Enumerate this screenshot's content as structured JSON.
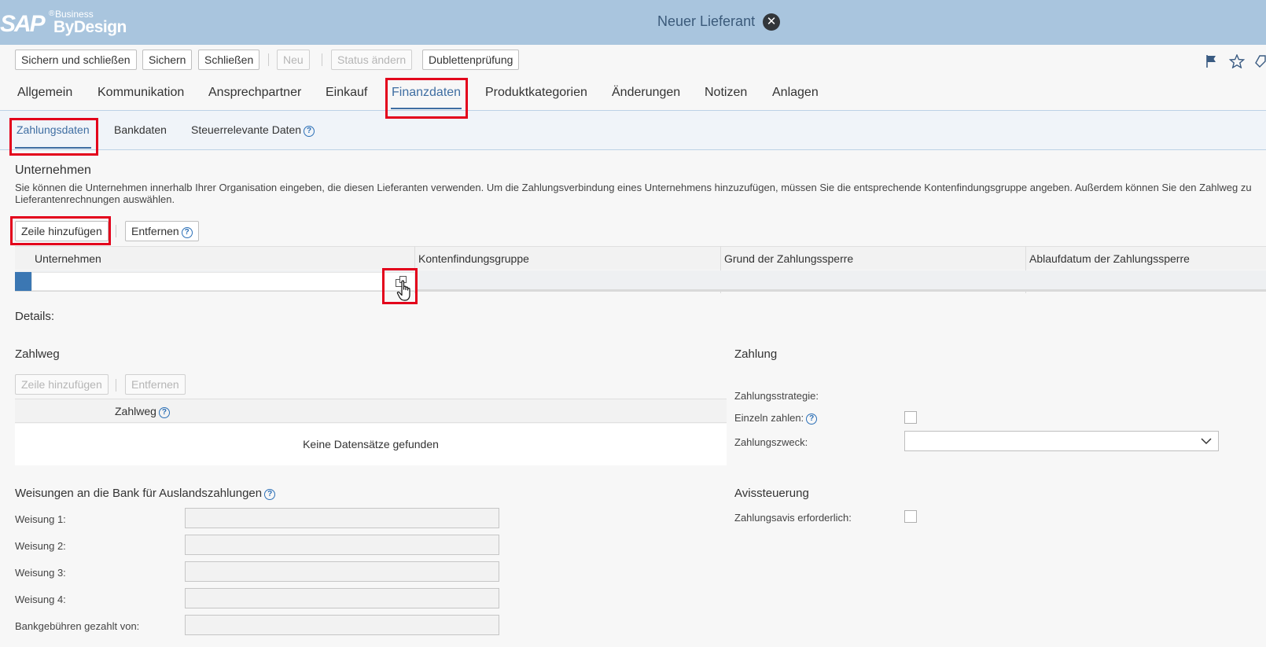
{
  "header": {
    "logo_sap": "SAP",
    "logo_reg": "®",
    "logo_business": "Business",
    "logo_bydesign": "ByDesign",
    "title": "Neuer Lieferant",
    "close_glyph": "✕"
  },
  "toolbar": {
    "save_close": "Sichern und schließen",
    "save": "Sichern",
    "close": "Schließen",
    "new": "Neu",
    "status": "Status ändern",
    "duplicate_check": "Dublettenprüfung"
  },
  "tabs": [
    {
      "label": "Allgemein"
    },
    {
      "label": "Kommunikation"
    },
    {
      "label": "Ansprechpartner"
    },
    {
      "label": "Einkauf"
    },
    {
      "label": "Finanzdaten"
    },
    {
      "label": "Produktkategorien"
    },
    {
      "label": "Änderungen"
    },
    {
      "label": "Notizen"
    },
    {
      "label": "Anlagen"
    }
  ],
  "subtabs": [
    {
      "label": "Zahlungsdaten"
    },
    {
      "label": "Bankdaten"
    },
    {
      "label": "Steuerrelevante Daten"
    }
  ],
  "company_section": {
    "title": "Unternehmen",
    "desc_line1": "Sie können die Unternehmen innerhalb Ihrer Organisation eingeben, die diesen Lieferanten verwenden. Um die Zahlungsverbindung eines Unternehmens hinzuzufügen, müssen Sie die entsprechende Kontenfindungsgruppe angeben. Außerdem können Sie den Zahlweg zu",
    "desc_line2": "Lieferantenrechnungen auswählen.",
    "add_row": "Zeile hinzufügen",
    "remove": "Entfernen",
    "columns": [
      "Unternehmen",
      "Kontenfindungsgruppe",
      "Grund der Zahlungssperre",
      "Ablaufdatum der Zahlungssperre"
    ]
  },
  "details": {
    "title": "Details:",
    "zahlweg_title": "Zahlweg",
    "add_row": "Zeile hinzufügen",
    "remove": "Entfernen",
    "zahlweg_col": "Zahlweg",
    "empty": "Keine Datensätze gefunden",
    "zahlung_title": "Zahlung",
    "strategy_label": "Zahlungsstrategie:",
    "single_label": "Einzeln zahlen:",
    "purpose_label": "Zahlungszweck:",
    "bank_title": "Weisungen an die Bank für Auslandszahlungen",
    "instr1": "Weisung 1:",
    "instr2": "Weisung 2:",
    "instr3": "Weisung 3:",
    "instr4": "Weisung 4:",
    "fees": "Bankgebühren gezahlt von:",
    "avis_title": "Avissteuerung",
    "avis_label": "Zahlungsavis erforderlich:"
  },
  "icons": {
    "flag": "flag-icon",
    "star": "star-icon",
    "help": "?",
    "value_help": "value-help-icon",
    "chevron": "chevron-down-icon"
  },
  "colors": {
    "header_bg": "#a9c5de",
    "accent": "#3f6ea2",
    "highlight": "#e3001b"
  }
}
